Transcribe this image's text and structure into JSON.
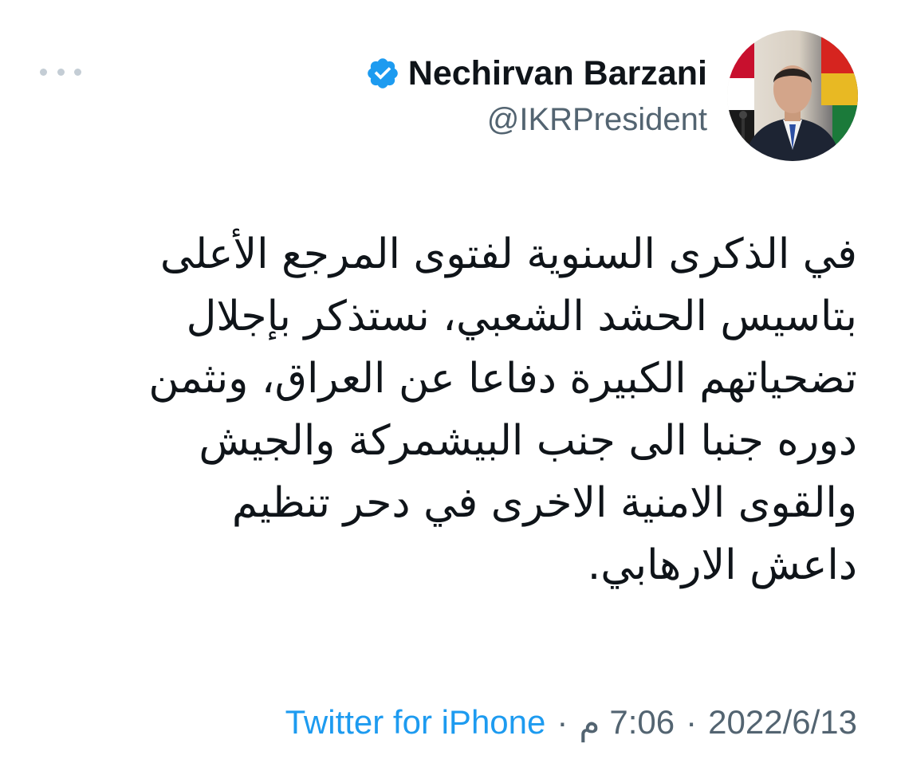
{
  "author": {
    "display_name": "Nechirvan Barzani",
    "handle": "@IKRPresident",
    "verified": true,
    "avatar_icon": "profile-photo"
  },
  "tweet": {
    "lines": [
      "في الذكرى السنوية لفتوى المرجع الأعلى",
      "بتاسيس الحشد الشعبي، نستذكر بإجلال",
      "تضحياتهم الكبيرة دفاعا عن العراق، ونثمن",
      "دوره جنبا الى جنب البيشمركة والجيش",
      "والقوى الامنية الاخرى في دحر تنظيم",
      "داعش الارهابي."
    ]
  },
  "meta": {
    "date": "2022/6/13",
    "separator": "·",
    "time": "7:06",
    "period": "م",
    "source": "Twitter for iPhone"
  },
  "colors": {
    "verified_badge": "#1d9bf0",
    "link": "#1d9bf0",
    "secondary_text": "#536471",
    "primary_text": "#0f1419"
  }
}
